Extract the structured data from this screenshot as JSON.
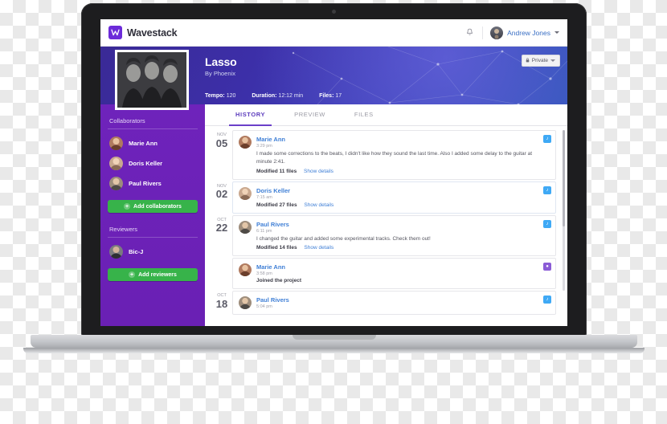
{
  "app": {
    "brand_name": "Wavestack",
    "brand_icon": "wavestack-logo",
    "notification_icon": "bell-icon",
    "user_name": "Andrew Jones",
    "user_menu_icon": "chevron-down-icon"
  },
  "hero": {
    "title": "Lasso",
    "artist": "By Phoenix",
    "meta": [
      {
        "label": "Tempo:",
        "value": "120"
      },
      {
        "label": "Duration:",
        "value": "12:12 min"
      },
      {
        "label": "Files:",
        "value": "17"
      }
    ],
    "privacy_label": "Private",
    "privacy_icon": "lock-icon",
    "privacy_caret_icon": "chevron-down-icon",
    "album_art_alt": "band-photo"
  },
  "sidebar": {
    "collaborators_label": "Collaborators",
    "collaborators": [
      {
        "name": "Marie Ann"
      },
      {
        "name": "Doris Keller"
      },
      {
        "name": "Paul Rivers"
      }
    ],
    "add_collaborators_label": "Add collaborators",
    "reviewers_label": "Reviewers",
    "reviewers": [
      {
        "name": "Bic-J"
      }
    ],
    "add_reviewers_label": "Add reviewers",
    "plus_icon": "plus-icon"
  },
  "tabs": [
    {
      "label": "HISTORY",
      "active": true
    },
    {
      "label": "PREVIEW",
      "active": false
    },
    {
      "label": "FILES",
      "active": false
    }
  ],
  "feed": [
    {
      "month": "Nov",
      "day": "05",
      "author": "Marie Ann",
      "time": "3:29 pm",
      "text": "I made some corrections to the beats, I didn't like how they sound the last time.  Also I added some delay to the guitar at minute 2:41.",
      "footer": "Modified 11 files",
      "link": "Show details",
      "badge": "music-note-icon",
      "badge_color": "#3fa9f5"
    },
    {
      "month": "Nov",
      "day": "02",
      "author": "Doris Keller",
      "time": "7:15 am",
      "text": "",
      "footer": "Modified 27 files",
      "link": "Show details",
      "badge": "music-note-icon",
      "badge_color": "#3fa9f5"
    },
    {
      "month": "Oct",
      "day": "22",
      "author": "Paul Rivers",
      "time": "6:11 pm",
      "text": "I changed the guitar and added some experimental tracks. Check them out!",
      "footer": "Modified 14 files",
      "link": "Show details",
      "badge": "music-note-icon",
      "badge_color": "#3fa9f5"
    },
    {
      "month": "",
      "day": "",
      "author": "Marie Ann",
      "time": "3:58 pm",
      "text": "",
      "footer": "Joined the project",
      "link": "",
      "badge": "person-icon",
      "badge_color": "#8b5cd6"
    },
    {
      "month": "Oct",
      "day": "18",
      "author": "Paul Rivers",
      "time": "5:04 pm",
      "text": "",
      "footer": "",
      "link": "",
      "badge": "music-note-icon",
      "badge_color": "#3fa9f5"
    }
  ],
  "colors": {
    "brand_purple": "#6c2bd9",
    "sidebar_purple": "#6a20b4",
    "green": "#37b34a",
    "link_blue": "#3f7fd6",
    "tab_active": "#5b3bbd"
  }
}
